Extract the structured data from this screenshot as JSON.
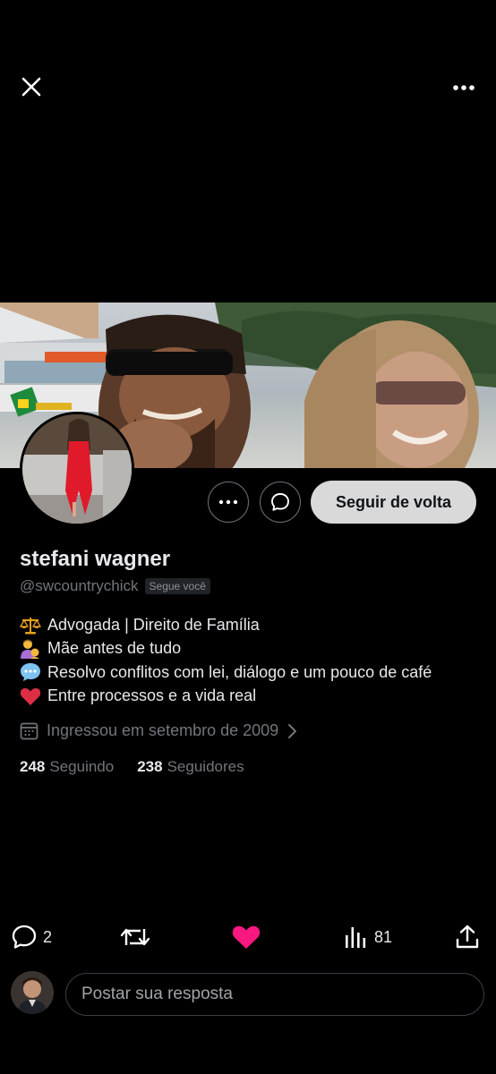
{
  "profile": {
    "name": "stefani wagner",
    "handle": "@swcountrychick",
    "follows_you": "Segue você",
    "follow_back_label": "Seguir de volta",
    "bio": [
      {
        "emoji": "scales-icon",
        "text": "Advogada | Direito de Família"
      },
      {
        "emoji": "mother-baby-icon",
        "text": "Mãe antes de tudo"
      },
      {
        "emoji": "speech-bubble-icon",
        "text": "Resolvo conflitos com lei, diálogo e um pouco de café"
      },
      {
        "emoji": "heart-icon",
        "text": "Entre processos e a vida real"
      }
    ],
    "joined": "Ingressou em setembro de 2009",
    "following_count": "248",
    "following_label": "Seguindo",
    "followers_count": "238",
    "followers_label": "Seguidores"
  },
  "actions": {
    "replies": "2",
    "views": "81",
    "liked": true,
    "like_color": "#f91880"
  },
  "reply": {
    "placeholder": "Postar sua resposta"
  },
  "colors": {
    "background": "#000000",
    "primary_text": "#e7e9ea",
    "secondary_text": "#71767b",
    "follow_button_bg": "#d9d9d9"
  }
}
